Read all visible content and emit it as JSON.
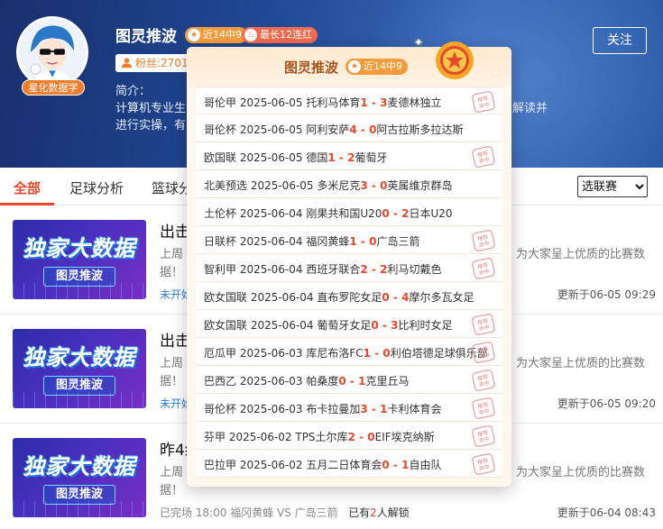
{
  "header": {
    "title": "图灵推波",
    "badge_recent": "近14中9",
    "badge_streak": "最长12连红",
    "fans": "粉丝:2701",
    "follow": "关注",
    "avatar_tag": "星化数据学",
    "intro_label": "简介：",
    "intro_line1": "计算机专业生",
    "intro_line2": "进行实操，有",
    "intro_right": "解读并"
  },
  "tabs": {
    "all": "全部",
    "football": "足球分析",
    "basketball": "篮球分"
  },
  "league_select": {
    "selected": "选联赛"
  },
  "articles": [
    {
      "title": "出击",
      "desc_line1": "上周",
      "desc_right": "为大家呈上优质的比赛数",
      "desc_line2": "据！",
      "status": "未开始",
      "update": "更新于06-05 09:29",
      "thumb_main": "独家大数据",
      "thumb_sub": "图灵推波"
    },
    {
      "title": "出击",
      "desc_line1": "上周",
      "desc_right": "为大家呈上优质的比赛数",
      "desc_line2": "据！",
      "status": "未开始",
      "update": "更新于06-05 09:20",
      "thumb_main": "独家大数据",
      "thumb_sub": "图灵推波"
    },
    {
      "title": "昨4红",
      "desc_line1": "上周",
      "desc_right": "为大家呈上优质的比赛数",
      "desc_line2": "据！",
      "status": "已完场 18:00 福冈黄蜂 VS 广岛三箭",
      "unlock_pre": "已有",
      "unlock_num": "2",
      "unlock_post": "人解锁",
      "update": "更新于06-04 08:43",
      "thumb_main": "独家大数据",
      "thumb_sub": "图灵推波"
    }
  ],
  "popup": {
    "title": "图灵推波",
    "badge": "近14中9",
    "stamp_text": "推荐命中",
    "rows": [
      {
        "pre": "哥伦甲 2025-06-05 托利马体育",
        "s1": "1",
        "sep": " - ",
        "s2": "3",
        "post": "麦德林独立",
        "hit": true
      },
      {
        "pre": "哥伦杯 2025-06-05 阿利安萨",
        "s1": "4",
        "sep": " - ",
        "s2": "0",
        "post": "阿古拉斯多拉达斯",
        "hit": false
      },
      {
        "pre": "欧国联 2025-06-05 德国",
        "s1": "1",
        "sep": " - ",
        "s2": "2",
        "post": "葡萄牙",
        "hit": true
      },
      {
        "pre": "北美预选 2025-06-05 多米尼克",
        "s1": "3",
        "sep": " - ",
        "s2": "0",
        "post": "英属维京群岛",
        "hit": false
      },
      {
        "pre": "土伦杯 2025-06-04 刚果共和国U20",
        "s1": "0",
        "sep": " - ",
        "s2": "2",
        "post": "日本U20",
        "hit": false
      },
      {
        "pre": "日联杯 2025-06-04 福冈黄蜂",
        "s1": "1",
        "sep": " - ",
        "s2": "0",
        "post": "广岛三箭",
        "hit": true
      },
      {
        "pre": "智利甲 2025-06-04 西班牙联合",
        "s1": "2",
        "sep": " - ",
        "s2": "2",
        "post": "利马切戴色",
        "hit": true
      },
      {
        "pre": "欧女国联 2025-06-04 直布罗陀女足",
        "s1": "0",
        "sep": " - ",
        "s2": "4",
        "post": "摩尔多瓦女足",
        "hit": false
      },
      {
        "pre": "欧女国联 2025-06-04 葡萄牙女足",
        "s1": "0",
        "sep": " - ",
        "s2": "3",
        "post": "比利时女足",
        "hit": true
      },
      {
        "pre": "厄瓜甲 2025-06-03 库尼布洛FC",
        "s1": "1",
        "sep": " - ",
        "s2": "0",
        "post": "利伯塔德足球俱乐部",
        "hit": true
      },
      {
        "pre": "巴西乙 2025-06-03 帕桑度",
        "s1": "0",
        "sep": " - ",
        "s2": "1",
        "post": "克里丘马",
        "hit": true
      },
      {
        "pre": "哥伦杯 2025-06-03 布卡拉曼加",
        "s1": "3",
        "sep": " - ",
        "s2": "1",
        "post": "卡利体育会",
        "hit": true
      },
      {
        "pre": "芬甲 2025-06-02 TPS土尔库",
        "s1": "2",
        "sep": " - ",
        "s2": "0",
        "post": "EIF埃克纳斯",
        "hit": true
      },
      {
        "pre": "巴拉甲 2025-06-02 五月二日体育会",
        "s1": "0",
        "sep": " - ",
        "s2": "1",
        "post": "自由队",
        "hit": true
      }
    ]
  },
  "colors": {
    "accent": "#e8472b",
    "badge_orange": "#f49b3b",
    "header_blue": "#1f4a96",
    "popup_bg": "#fff7ec"
  }
}
